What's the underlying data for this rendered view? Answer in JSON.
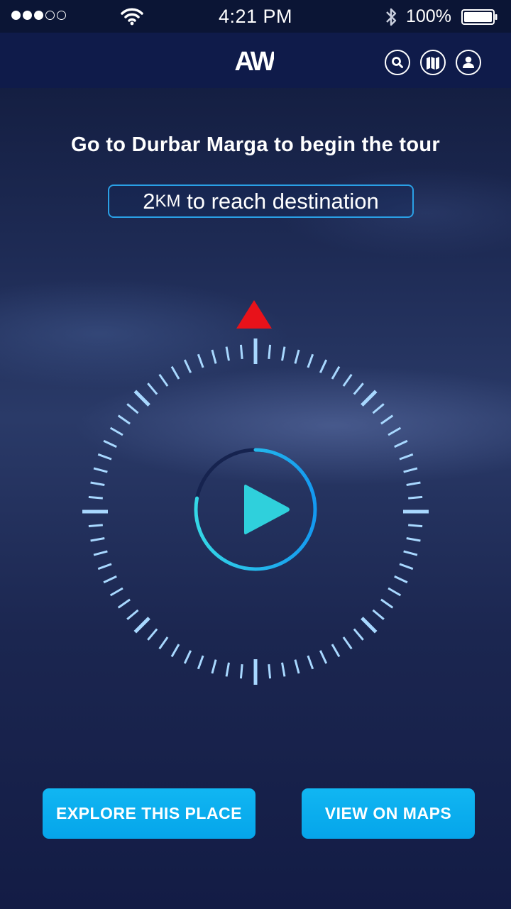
{
  "status_bar": {
    "signal_filled": 3,
    "signal_total": 5,
    "time": "4:21 PM",
    "battery_percent": "100%"
  },
  "nav": {
    "logo_text": "AW",
    "icons": [
      "search-icon",
      "map-icon",
      "user-icon"
    ]
  },
  "main": {
    "headline": "Go to Durbar Marga to begin the tour",
    "distance_value": "2",
    "distance_unit": "KM",
    "distance_text": " to reach destination",
    "playback_progress": 0.78
  },
  "actions": {
    "explore_label": "EXPLORE THIS PLACE",
    "maps_label": "VIEW ON MAPS"
  },
  "colors": {
    "accent": "#05a5ea",
    "north_marker": "#e8121a",
    "tick": "#a8d8ff",
    "play": "#2fd0dc"
  }
}
